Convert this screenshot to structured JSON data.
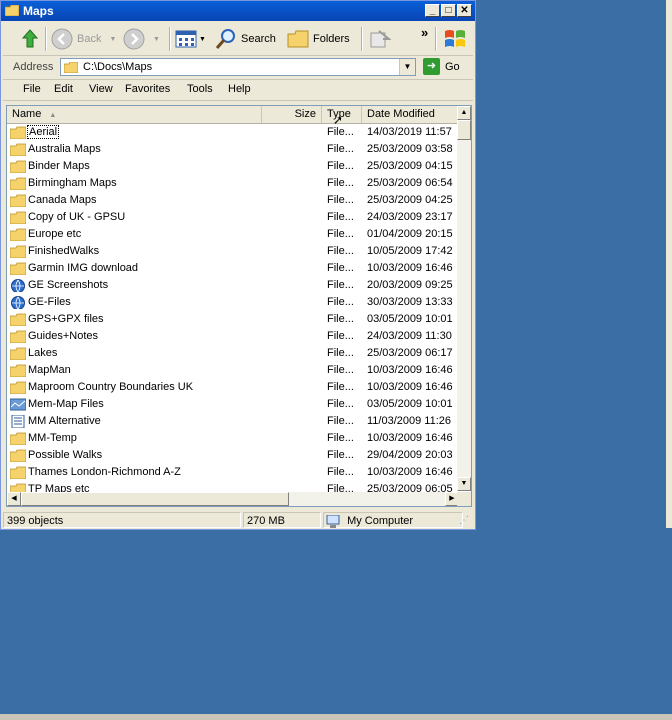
{
  "window": {
    "title": "Maps"
  },
  "toolbar": {
    "back_label": "Back",
    "search_label": "Search",
    "folders_label": "Folders",
    "overflow": "»"
  },
  "address": {
    "label": "Address",
    "value": "C:\\Docs\\Maps",
    "go_label": "Go"
  },
  "menu": [
    "File",
    "Edit",
    "View",
    "Favorites",
    "Tools",
    "Help"
  ],
  "columns": {
    "name": "Name",
    "size": "Size",
    "type": "Type",
    "date": "Date Modified"
  },
  "rows": [
    {
      "name": "Aerial",
      "type": "File...",
      "date": "14/03/2019 11:57",
      "icon": "folder-icon",
      "selected": true
    },
    {
      "name": "Australia Maps",
      "type": "File...",
      "date": "25/03/2009 03:58",
      "icon": "folder-icon"
    },
    {
      "name": "Binder Maps",
      "type": "File...",
      "date": "25/03/2009 04:15",
      "icon": "folder-icon"
    },
    {
      "name": "Birmingham Maps",
      "type": "File...",
      "date": "25/03/2009 06:54",
      "icon": "folder-icon"
    },
    {
      "name": "Canada Maps",
      "type": "File...",
      "date": "25/03/2009 04:25",
      "icon": "folder-icon"
    },
    {
      "name": "Copy of UK - GPSU",
      "type": "File...",
      "date": "24/03/2009 23:17",
      "icon": "folder-icon"
    },
    {
      "name": "Europe etc",
      "type": "File...",
      "date": "01/04/2009 20:15",
      "icon": "folder-icon"
    },
    {
      "name": "FinishedWalks",
      "type": "File...",
      "date": "10/05/2009 17:42",
      "icon": "folder-icon"
    },
    {
      "name": "Garmin IMG download",
      "type": "File...",
      "date": "10/03/2009 16:46",
      "icon": "folder-icon"
    },
    {
      "name": "GE Screenshots",
      "type": "File...",
      "date": "20/03/2009 09:25",
      "icon": "globe-icon"
    },
    {
      "name": "GE-Files",
      "type": "File...",
      "date": "30/03/2009 13:33",
      "icon": "globe-icon"
    },
    {
      "name": "GPS+GPX files",
      "type": "File...",
      "date": "03/05/2009 10:01",
      "icon": "folder-icon"
    },
    {
      "name": "Guides+Notes",
      "type": "File...",
      "date": "24/03/2009 11:30",
      "icon": "folder-icon"
    },
    {
      "name": "Lakes",
      "type": "File...",
      "date": "25/03/2009 06:17",
      "icon": "folder-icon"
    },
    {
      "name": "MapMan",
      "type": "File...",
      "date": "10/03/2009 16:46",
      "icon": "folder-icon"
    },
    {
      "name": "Maproom Country Boundaries UK",
      "type": "File...",
      "date": "10/03/2009 16:46",
      "icon": "folder-icon"
    },
    {
      "name": "Mem-Map Files",
      "type": "File...",
      "date": "03/05/2009 10:01",
      "icon": "map-folder-icon"
    },
    {
      "name": "MM Alternative",
      "type": "File...",
      "date": "11/03/2009 11:26",
      "icon": "document-icon"
    },
    {
      "name": "MM-Temp",
      "type": "File...",
      "date": "10/03/2009 16:46",
      "icon": "folder-icon"
    },
    {
      "name": "Possible Walks",
      "type": "File...",
      "date": "29/04/2009 20:03",
      "icon": "folder-icon"
    },
    {
      "name": "Thames London-Richmond A-Z",
      "type": "File...",
      "date": "10/03/2009 16:46",
      "icon": "folder-icon"
    },
    {
      "name": "TP Maps etc",
      "type": "File...",
      "date": "25/03/2009 06:05",
      "icon": "folder-icon"
    }
  ],
  "status": {
    "objects": "399 objects",
    "size": "270 MB",
    "location": "My Computer"
  },
  "colors": {
    "desktop": "#3a6ea5",
    "titlebar": "#0a5fd8",
    "folder": "#f5d26b"
  }
}
